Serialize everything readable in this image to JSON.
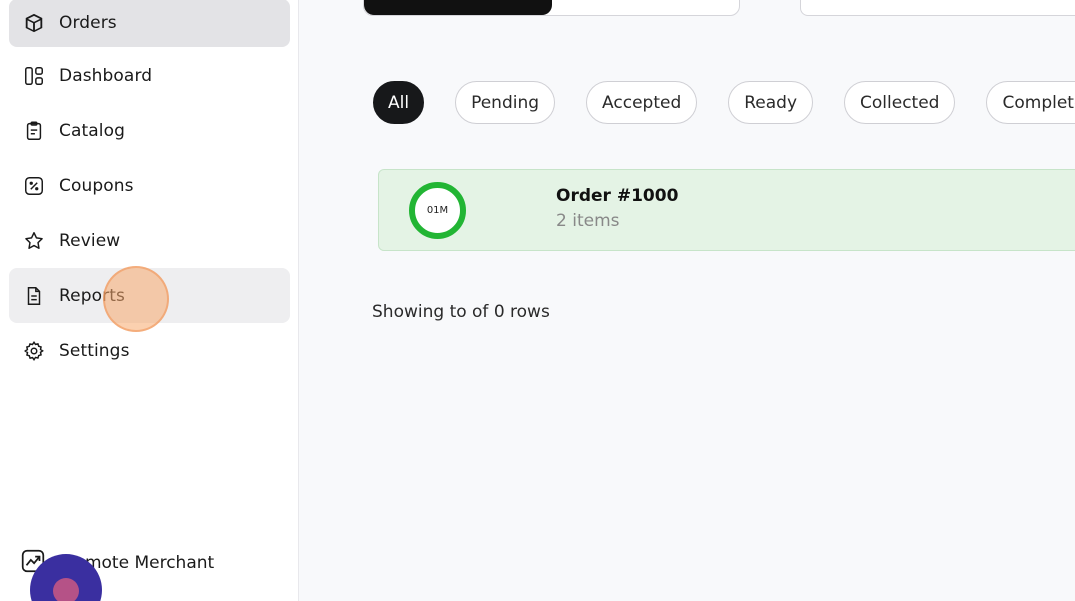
{
  "sidebar": {
    "items": [
      {
        "label": "Orders",
        "icon": "box-icon"
      },
      {
        "label": "Dashboard",
        "icon": "layout-icon"
      },
      {
        "label": "Catalog",
        "icon": "clipboard-icon"
      },
      {
        "label": "Coupons",
        "icon": "percent-icon"
      },
      {
        "label": "Review",
        "icon": "star-icon"
      },
      {
        "label": "Reports",
        "icon": "file-text-icon"
      },
      {
        "label": "Settings",
        "icon": "gear-icon"
      }
    ],
    "promote_label": "Promote Merchant"
  },
  "filters": [
    "All",
    "Pending",
    "Accepted",
    "Ready",
    "Collected",
    "Completed"
  ],
  "order": {
    "timer": "01M",
    "title": "Order #1000",
    "subtitle": "2 items"
  },
  "pagination_text": "Showing to of 0 rows",
  "colors": {
    "accent_dark": "#17181a",
    "order_bg": "#e4f3e5",
    "timer_ring": "#22b534",
    "fab": "#3a2fa0"
  }
}
